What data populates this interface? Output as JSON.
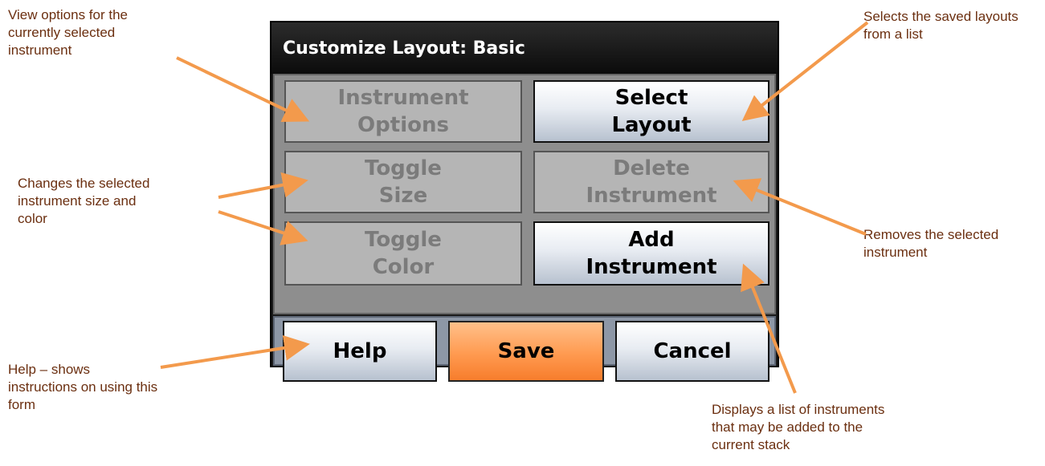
{
  "dialog": {
    "title": "Customize Layout: Basic",
    "buttons": {
      "instrument_options": [
        "Instrument",
        "Options"
      ],
      "select_layout": [
        "Select",
        "Layout"
      ],
      "toggle_size": [
        "Toggle",
        "Size"
      ],
      "delete_instrument": [
        "Delete",
        "Instrument"
      ],
      "toggle_color": [
        "Toggle",
        "Color"
      ],
      "add_instrument": [
        "Add",
        "Instrument"
      ]
    },
    "footer": {
      "help": "Help",
      "save": "Save",
      "cancel": "Cancel"
    }
  },
  "annotations": {
    "view_options": [
      "View options for the",
      "currently selected",
      "instrument"
    ],
    "changes_size": [
      "Changes the selected",
      "instrument size and",
      "color"
    ],
    "help": [
      "Help – shows",
      "instructions on using this",
      "form"
    ],
    "select_layout": [
      "Selects the saved layouts",
      "from a list"
    ],
    "removes": [
      "Removes the selected",
      "instrument"
    ],
    "displays": [
      "Displays a list of instruments",
      "that may be added to the",
      "current stack"
    ]
  },
  "colors": {
    "arrow": "#f39a4c",
    "annotation_text": "#6b2f10",
    "save_button": "#ff9a50",
    "title_bar": "#111111"
  }
}
